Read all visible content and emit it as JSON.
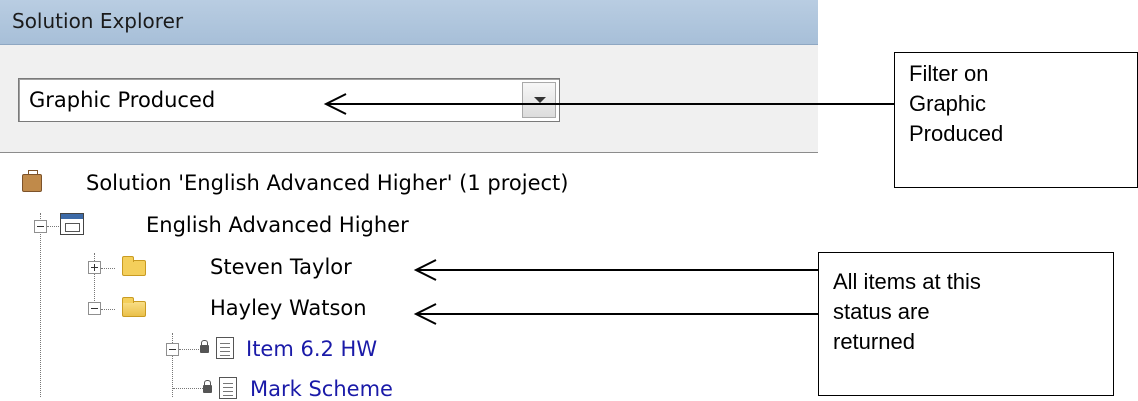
{
  "panel": {
    "title": "Solution Explorer",
    "filter": {
      "selected": "Graphic Produced"
    }
  },
  "tree": {
    "solution": "Solution 'English Advanced Higher' (1 project)",
    "project": "English Advanced Higher",
    "folders": [
      {
        "label": "Steven Taylor",
        "expanded": false
      },
      {
        "label": "Hayley Watson",
        "expanded": true
      }
    ],
    "item": "Item 6.2 HW",
    "subitem": "Mark Scheme"
  },
  "annotations": {
    "filter_note": [
      "Filter on",
      "Graphic",
      "Produced"
    ],
    "status_note": [
      "All items at this",
      "status are",
      "returned"
    ]
  }
}
